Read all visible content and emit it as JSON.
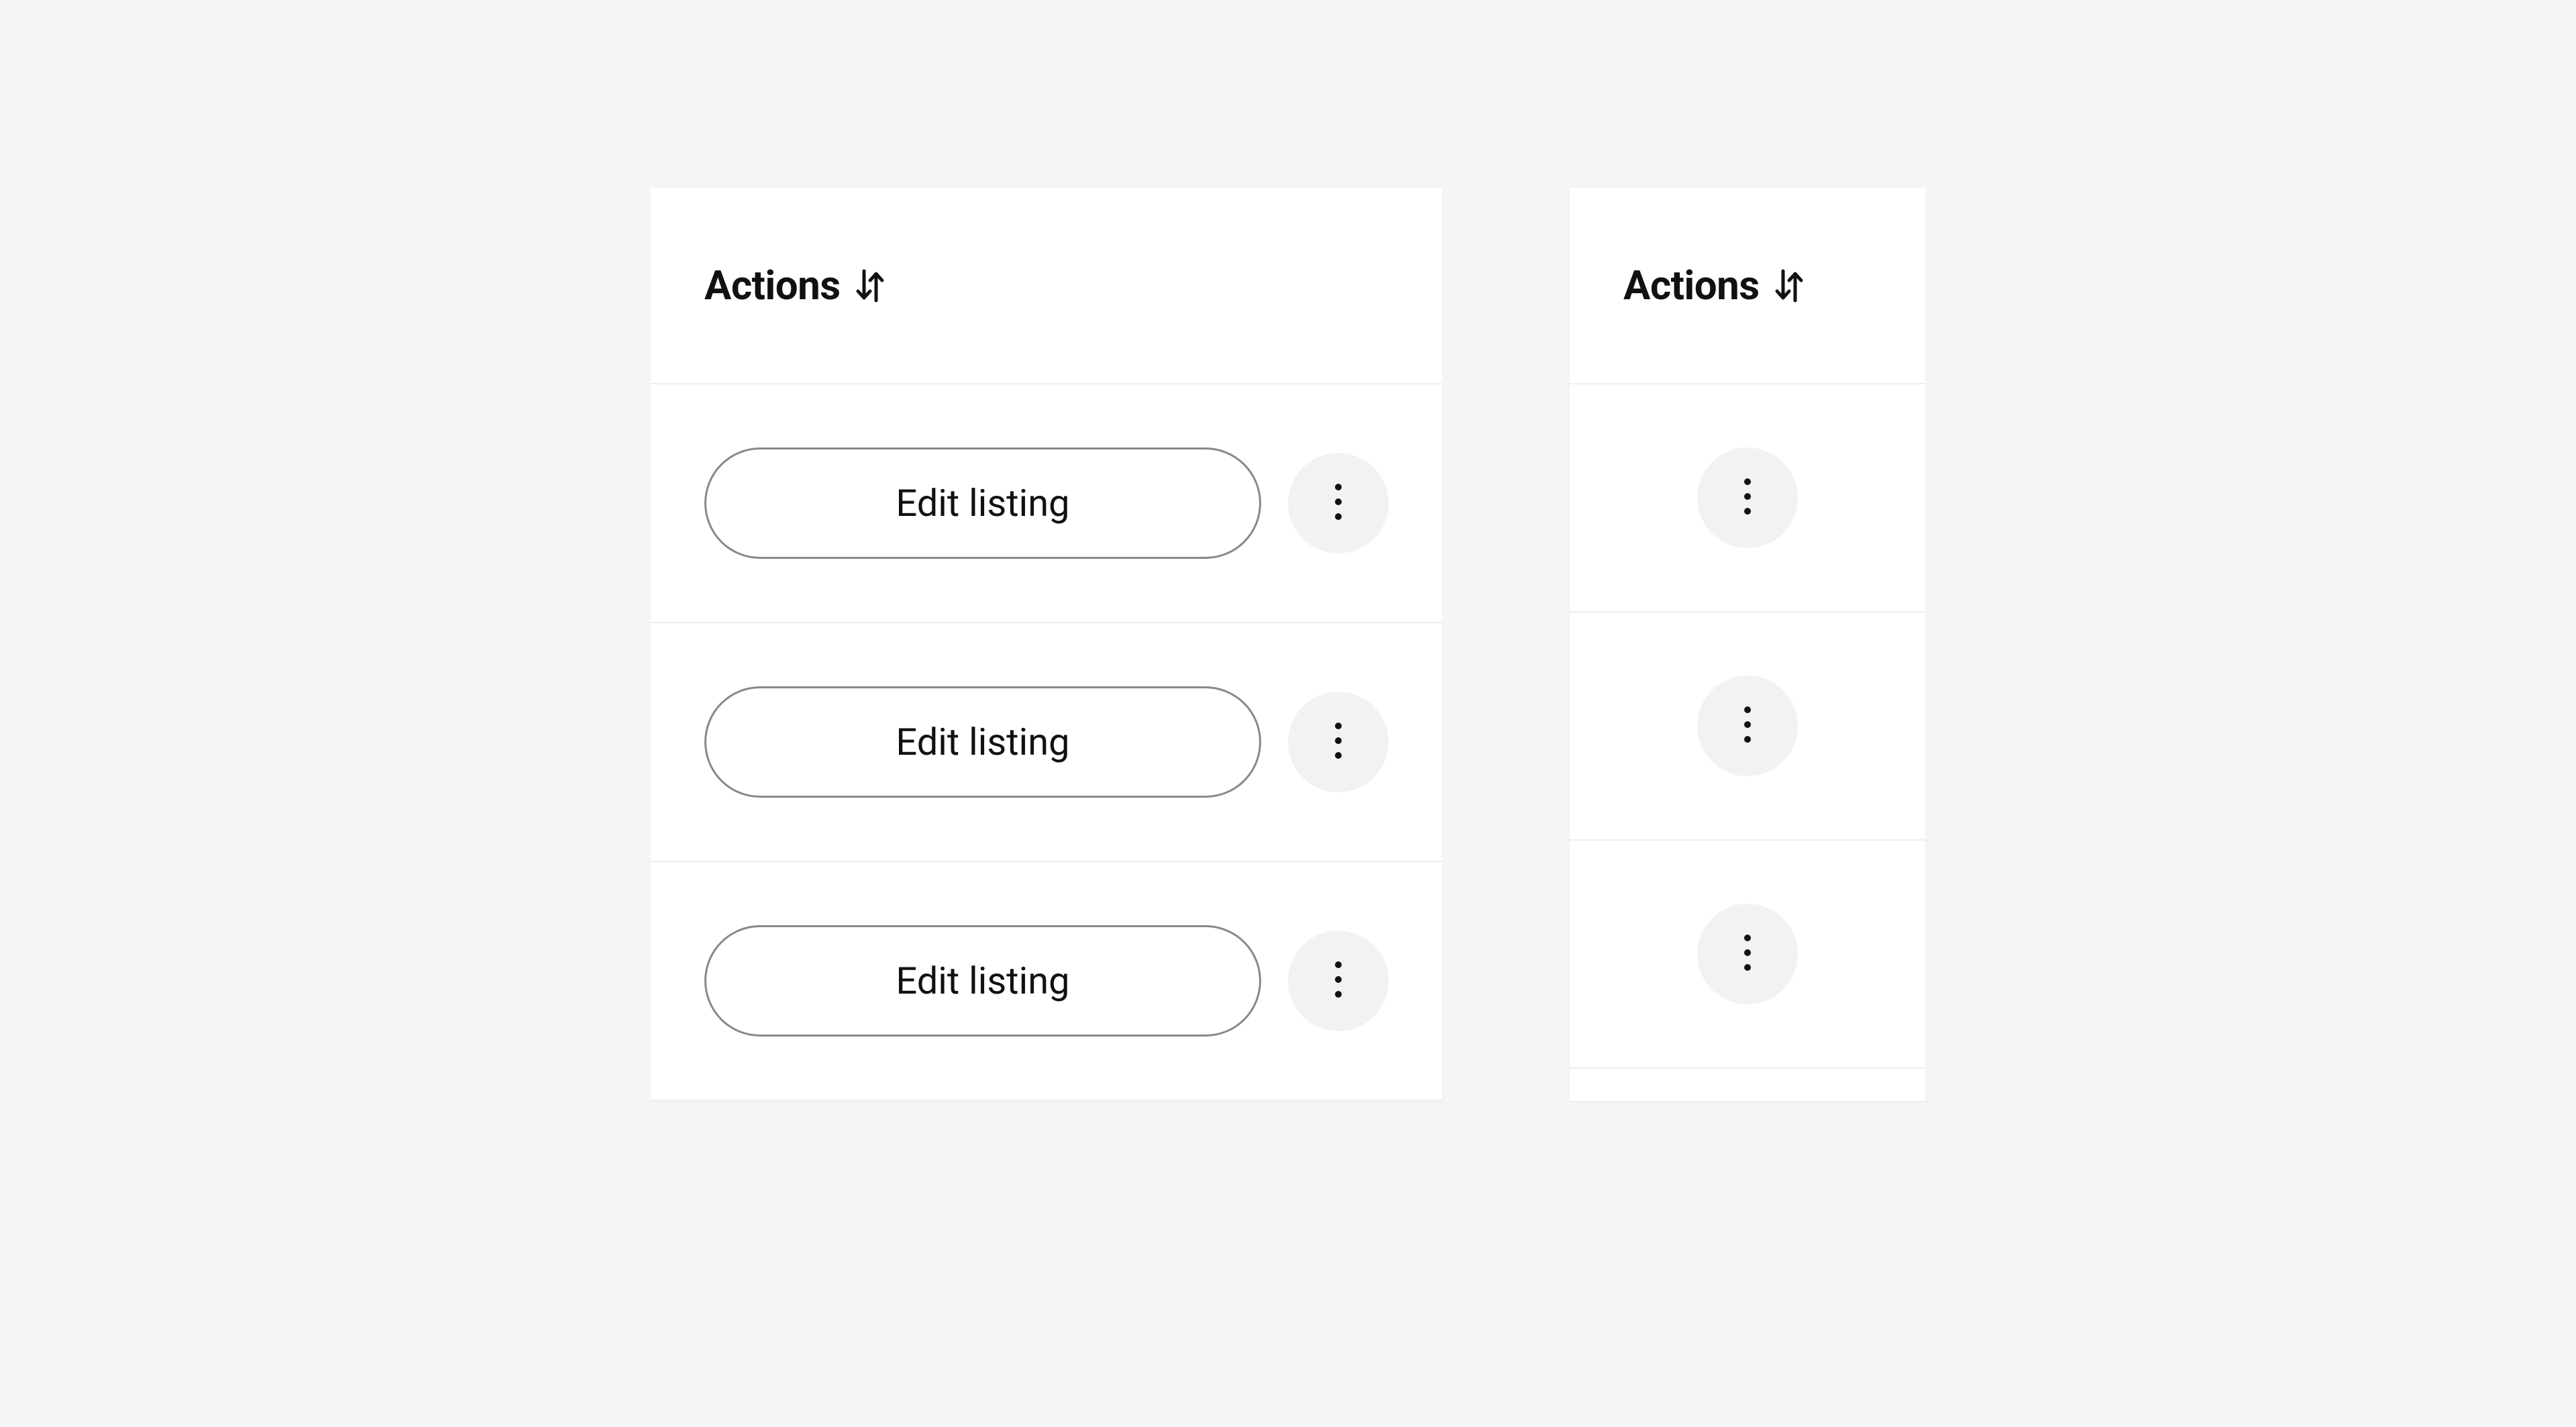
{
  "columns": {
    "wide": {
      "header": "Actions",
      "rows": [
        {
          "button_label": "Edit listing"
        },
        {
          "button_label": "Edit listing"
        },
        {
          "button_label": "Edit listing"
        }
      ]
    },
    "narrow": {
      "header": "Actions",
      "rows": [
        {},
        {},
        {}
      ]
    }
  }
}
